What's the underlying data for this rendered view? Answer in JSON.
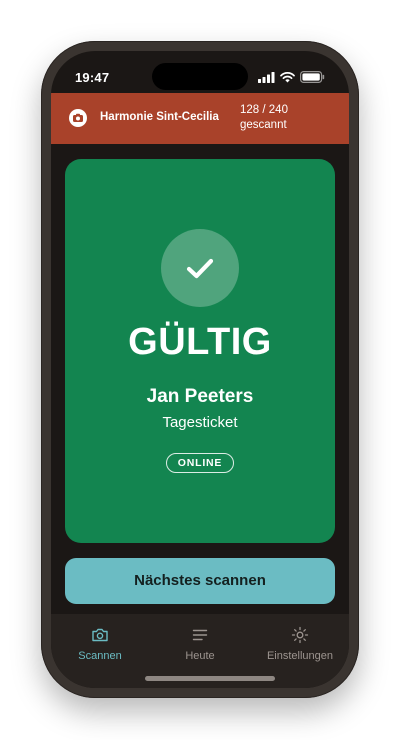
{
  "status_bar": {
    "time": "19:47",
    "icons": [
      "signal-icon",
      "wifi-icon",
      "battery-icon"
    ]
  },
  "header": {
    "logo_icon": "camera-logo-icon",
    "org_name": "Harmonie Sint-Cecilia",
    "scan_count": "128 / 240",
    "scan_count_label": "gescannt"
  },
  "result": {
    "icon": "checkmark-icon",
    "status": "GÜLTIG",
    "holder_name": "Jan Peeters",
    "ticket_type": "Tagesticket",
    "mode_badge": "ONLINE"
  },
  "actions": {
    "next_scan_label": "Nächstes scannen"
  },
  "tabs": [
    {
      "label": "Scannen",
      "icon": "camera-icon",
      "active": true
    },
    {
      "label": "Heute",
      "icon": "list-icon",
      "active": false
    },
    {
      "label": "Einstellungen",
      "icon": "gear-icon",
      "active": false
    }
  ],
  "colors": {
    "header_bg": "#a9422a",
    "valid_green": "#138550",
    "accent_teal": "#6bbcc3",
    "screen_bg": "#1b1715",
    "tab_bar_bg": "#27221f"
  }
}
